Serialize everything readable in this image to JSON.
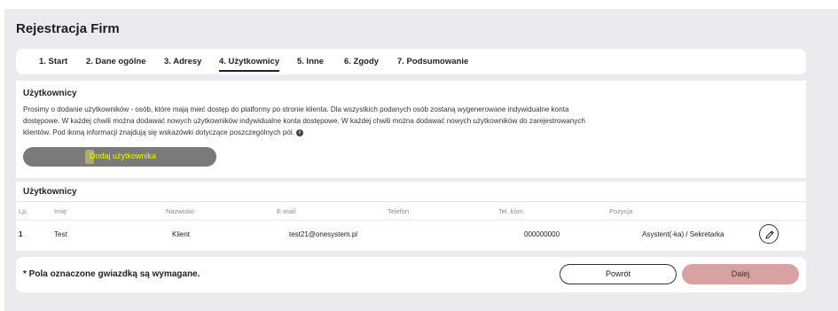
{
  "page": {
    "title": "Rejestracja Firm"
  },
  "tabs": [
    {
      "label": "1. Start"
    },
    {
      "label": "2. Dane ogólne"
    },
    {
      "label": "3. Adresy"
    },
    {
      "label": "4. Użytkownicy"
    },
    {
      "label": "5. Inne"
    },
    {
      "label": "6. Zgody"
    },
    {
      "label": "7. Podsumowanie"
    }
  ],
  "info": {
    "title": "Użytkownicy",
    "line1": "Prosimy o dodanie użytkowników - osób, które mają mieć dostęp do platformy po stronie klienta. Dla wszystkich podanych osób zostaną wygenerowane indywidualne konta",
    "line2": "dostępowe. W każdej chwili można dodawać nowych użytkowników indywidualne konta dostępowe. W każdej chwili można dodawać nowych użytkowników do zarejestrowanych",
    "line3": "klientów. Pod ikoną informacji znajdują się wskazówki dotyczące poszczególnych pól.",
    "info_icon": "info-icon",
    "add_button": "Dodaj użytkownika"
  },
  "users": {
    "title": "Użytkownicy",
    "columns": [
      "Lp.",
      "Imię",
      "Nazwisko",
      "E-mail",
      "Telefon",
      "Tel. kom.",
      "Pozycja"
    ],
    "rows": [
      {
        "lp": "1",
        "imie": "Test",
        "nazwisko": "Klient",
        "email": "test21@onesystem.pl",
        "telefon": "",
        "tel_kom": "000000000",
        "pozycja": "Asystent(-ka) / Sekretarka",
        "action_icon": "pencil-icon"
      }
    ]
  },
  "footer": {
    "required_note": "* Pola oznaczone gwiazdką są wymagane.",
    "back_label": "Powrót",
    "next_label": "Dalej"
  },
  "colors": {
    "page_bg": "#ebebed",
    "card_bg": "#ffffff",
    "add_button_bg": "#7a7a7a",
    "add_button_text": "#f4f200",
    "next_button_bg": "#d9a1a1"
  }
}
